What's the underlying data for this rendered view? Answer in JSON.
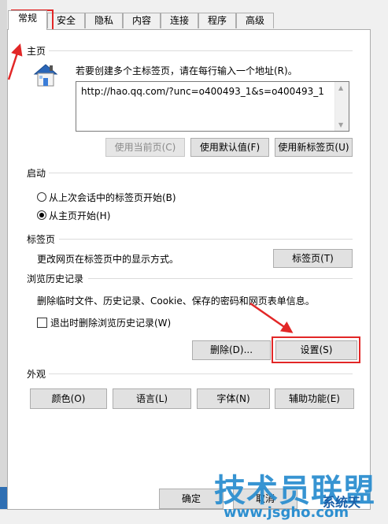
{
  "tabs": [
    {
      "label": "常规",
      "active": true
    },
    {
      "label": "安全"
    },
    {
      "label": "隐私"
    },
    {
      "label": "内容"
    },
    {
      "label": "连接"
    },
    {
      "label": "程序"
    },
    {
      "label": "高级"
    }
  ],
  "homepage": {
    "title": "主页",
    "instruction": "若要创建多个主标签页，请在每行输入一个地址(R)。",
    "url": "http://hao.qq.com/?unc=o400493_1&s=o400493_1",
    "btn_current": "使用当前页(C)",
    "btn_default": "使用默认值(F)",
    "btn_newtab": "使用新标签页(U)"
  },
  "startup": {
    "title": "启动",
    "option_last": "从上次会话中的标签页开始(B)",
    "option_home": "从主页开始(H)",
    "selected": "option_home"
  },
  "tabsection": {
    "title": "标签页",
    "desc": "更改网页在标签页中的显示方式。",
    "btn": "标签页(T)"
  },
  "history": {
    "title": "浏览历史记录",
    "desc": "删除临时文件、历史记录、Cookie、保存的密码和网页表单信息。",
    "checkbox_label": "退出时删除浏览历史记录(W)",
    "checked": false,
    "btn_delete": "删除(D)...",
    "btn_settings": "设置(S)"
  },
  "appearance": {
    "title": "外观",
    "btn_colors": "颜色(O)",
    "btn_languages": "语言(L)",
    "btn_fonts": "字体(N)",
    "btn_accessibility": "辅助功能(E)"
  },
  "footer": {
    "btn_ok": "确定",
    "btn_cancel": "取消"
  },
  "watermark": {
    "brand": "技术员联盟",
    "url": "www.jsgho.com",
    "partial": "系统天"
  },
  "colors": {
    "highlight": "#e22727"
  }
}
